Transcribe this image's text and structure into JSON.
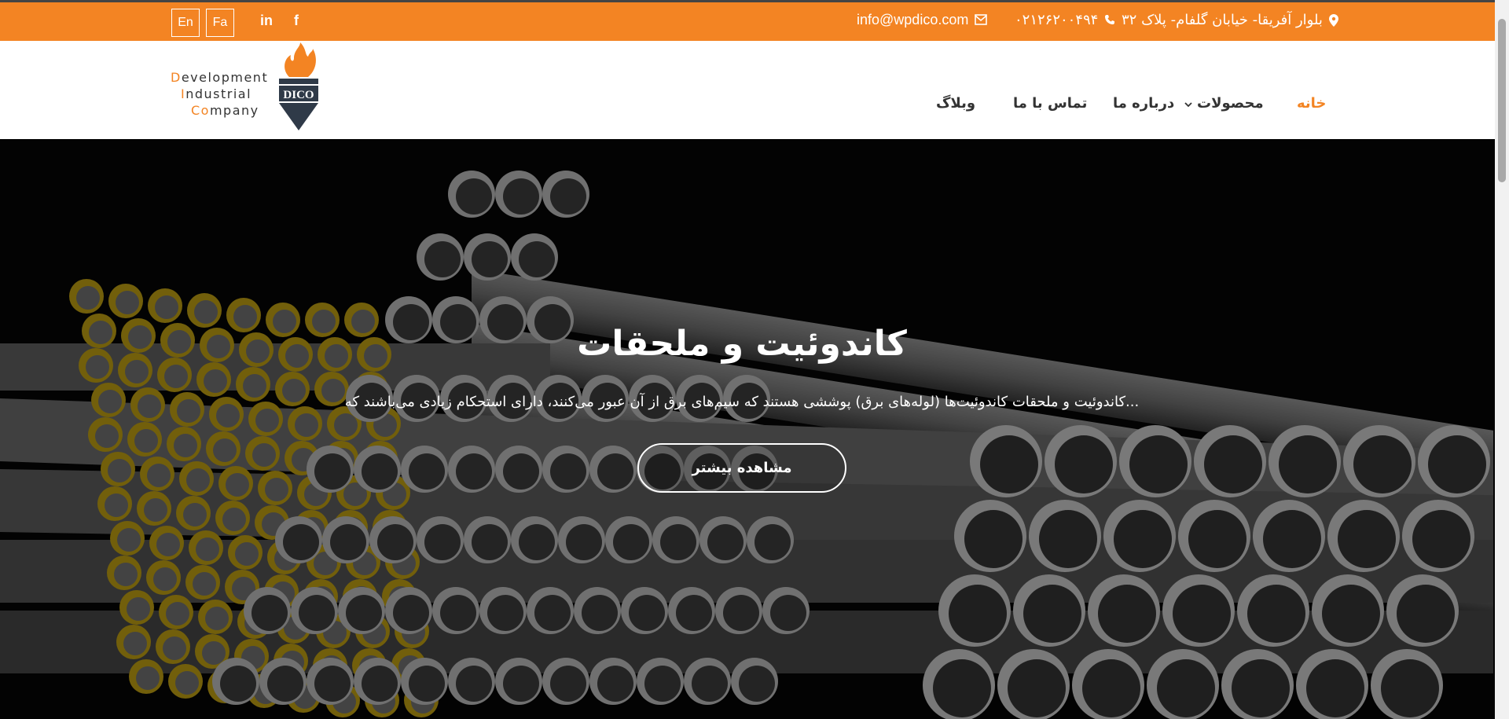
{
  "topbar": {
    "lang_en": "En",
    "lang_fa": "Fa",
    "social_linkedin": "in",
    "social_facebook": "f",
    "email": "info@wpdico.com",
    "phone": "۰۲۱۲۶۲۰۰۴۹۴",
    "address": "بلوار آفریقا- خیابان گلفام- پلاک ۳۲",
    "accent_color": "#f38423"
  },
  "logo": {
    "line1_first": "D",
    "line1_rest": "evelopment",
    "line2_first": "I",
    "line2_rest": "ndustrial",
    "line3_first": "Co",
    "line3_rest": "mpany",
    "mark_text": "DICO"
  },
  "nav": {
    "home": "خانه",
    "products": "محصولات",
    "about": "درباره ما",
    "contact": "تماس با ما",
    "blog": "وبلاگ"
  },
  "hero": {
    "title": "کاندوئیت و ملحقات",
    "subtitle": "کاندوئیت و ملحقات کاندوئیت‌ها (لوله‌های برق) پوششی هستند که سیم‌های برق از آن عبور می‌کنند، دارای استحکام زیادی می‌باشند که...",
    "button": "مشاهده بیشتر"
  }
}
